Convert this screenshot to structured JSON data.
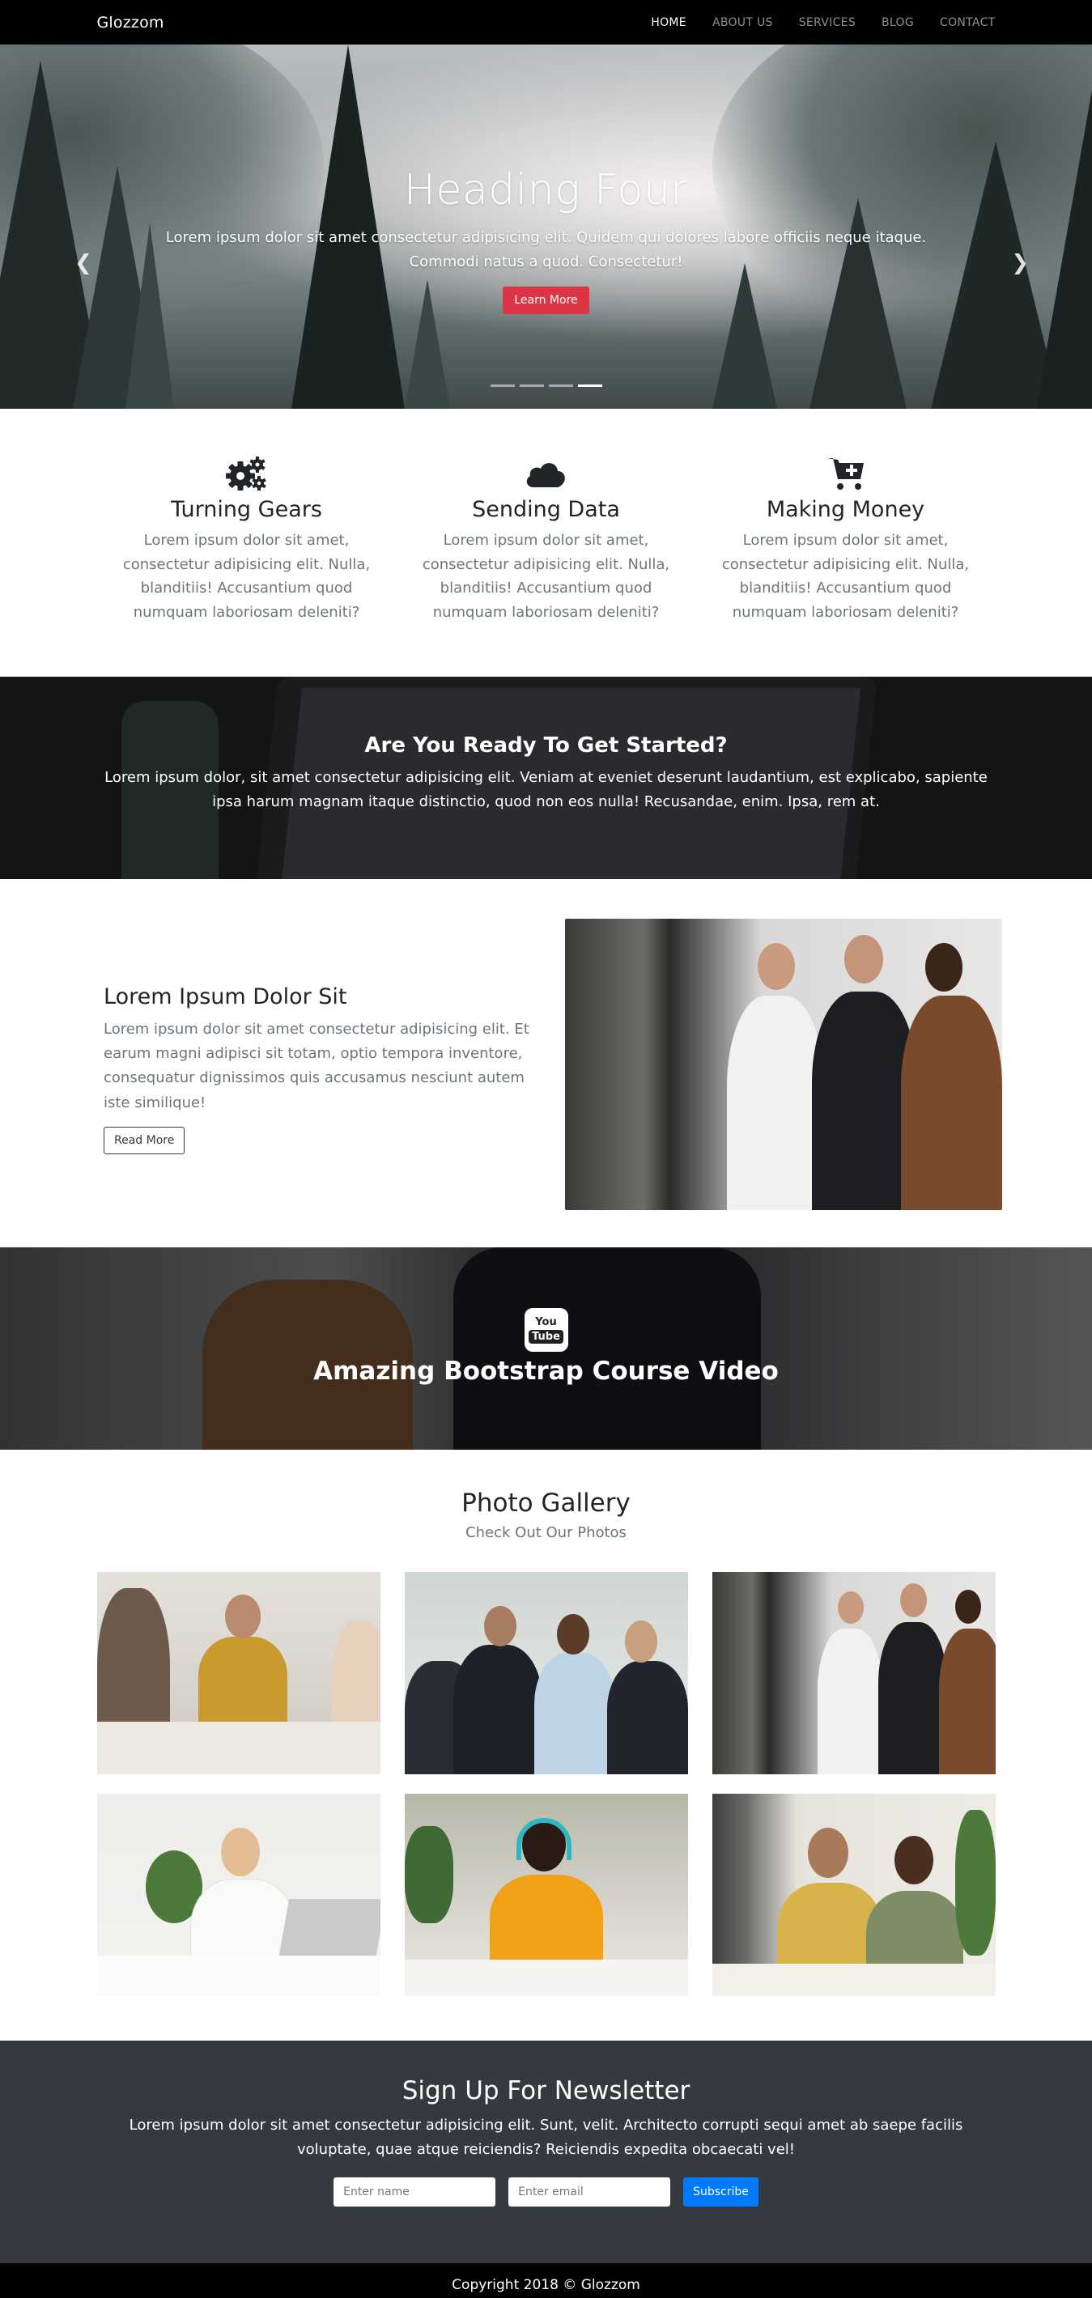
{
  "nav": {
    "brand": "Glozzom",
    "items": [
      {
        "label": "HOME",
        "active": true
      },
      {
        "label": "ABOUT US"
      },
      {
        "label": "SERVICES"
      },
      {
        "label": "BLOG"
      },
      {
        "label": "CONTACT"
      }
    ]
  },
  "hero": {
    "title": "Heading Four",
    "text": "Lorem ipsum dolor sit amet consectetur adipisicing elit. Quidem qui dolores labore officiis neque itaque. Commodi natus a quod. Consectetur!",
    "button": "Learn More",
    "prev_icon": "chevron-left-icon",
    "next_icon": "chevron-right-icon",
    "active_slide": 4,
    "slide_count": 4
  },
  "features": [
    {
      "icon": "gears-icon",
      "title": "Turning Gears",
      "text": "Lorem ipsum dolor sit amet, consectetur adipisicing elit. Nulla, blanditiis! Accusantium quod numquam laboriosam deleniti?"
    },
    {
      "icon": "cloud-icon",
      "title": "Sending Data",
      "text": "Lorem ipsum dolor sit amet, consectetur adipisicing elit. Nulla, blanditiis! Accusantium quod numquam laboriosam deleniti?"
    },
    {
      "icon": "cart-plus-icon",
      "title": "Making Money",
      "text": "Lorem ipsum dolor sit amet, consectetur adipisicing elit. Nulla, blanditiis! Accusantium quod numquam laboriosam deleniti?"
    }
  ],
  "get_started": {
    "title": "Are You Ready To Get Started?",
    "text": "Lorem ipsum dolor, sit amet consectetur adipisicing elit. Veniam at eveniet deserunt laudantium, est explicabo, sapiente ipsa harum magnam itaque distinctio, quod non eos nulla! Recusandae, enim. Ipsa, rem at."
  },
  "info": {
    "title": "Lorem Ipsum Dolor Sit",
    "text": "Lorem ipsum dolor sit amet consectetur adipisicing elit. Et earum magni adipisci sit totam, optio tempora inventore, consequatur dignissimos quis accusamus nesciunt autem iste similique!",
    "button": "Read More"
  },
  "video": {
    "icon": "youtube-icon",
    "icon_top": "You",
    "icon_bottom": "Tube",
    "title": "Amazing Bootstrap Course Video"
  },
  "gallery": {
    "title": "Photo Gallery",
    "subtitle": "Check Out Our Photos",
    "images": [
      "handshake-meeting-photo",
      "business-team-handshake-photo",
      "three-colleagues-photo",
      "woman-at-laptop-photo",
      "student-with-headphones-photo",
      "support-team-headsets-photo"
    ]
  },
  "newsletter": {
    "title": "Sign Up For Newsletter",
    "text": "Lorem ipsum dolor sit amet consectetur adipisicing elit. Sunt, velit. Architecto corrupti sequi amet ab saepe facilis voluptate, quae atque reiciendis? Reiciendis expedita obcaecati vel!",
    "name_placeholder": "Enter name",
    "email_placeholder": "Enter email",
    "button": "Subscribe"
  },
  "footer": {
    "text": "Copyright 2018 © Glozzom"
  },
  "colors": {
    "nav_bg": "#000000",
    "cta_red": "#dc3545",
    "subscribe_blue": "#007bff",
    "newsletter_bg": "#343a40"
  }
}
